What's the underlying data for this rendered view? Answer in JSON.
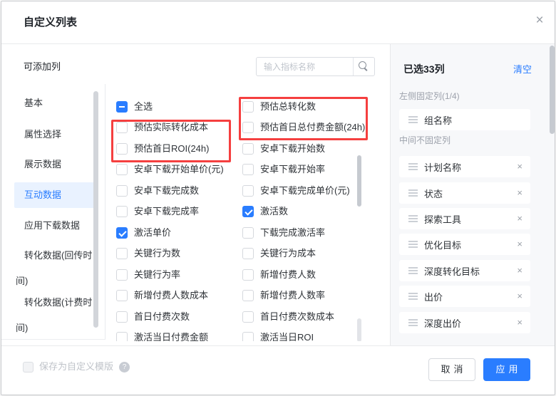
{
  "dialog": {
    "title": "自定义列表"
  },
  "icons": {
    "close": "×",
    "remove": "×",
    "help": "?",
    "search": "magnifier-icon",
    "drag": "triple-bar-handle"
  },
  "addable": {
    "label": "可添加列",
    "search_placeholder": "输入指标名称",
    "categories": [
      {
        "label": "基本",
        "active": false
      },
      {
        "label": "属性选择",
        "active": false
      },
      {
        "label": "展示数据",
        "active": false
      },
      {
        "label": "互动数据",
        "active": true
      },
      {
        "label": "应用下载数据",
        "active": false
      },
      {
        "label": "转化数据(回传时\n间)",
        "active": false
      },
      {
        "label": "转化数据(计费时\n间)",
        "active": false
      }
    ]
  },
  "metrics": {
    "col1": [
      {
        "label": "全选",
        "state": "indeterminate",
        "highlighted": false
      },
      {
        "label": "预估实际转化成本",
        "state": "unchecked",
        "highlighted": true
      },
      {
        "label": "预估首日ROI(24h)",
        "state": "unchecked",
        "highlighted": true
      },
      {
        "label": "安卓下载开始单价(元)",
        "state": "unchecked",
        "highlighted": false
      },
      {
        "label": "安卓下载完成数",
        "state": "unchecked",
        "highlighted": false
      },
      {
        "label": "安卓下载完成率",
        "state": "unchecked",
        "highlighted": false
      },
      {
        "label": "激活单价",
        "state": "checked",
        "highlighted": false
      },
      {
        "label": "关键行为数",
        "state": "unchecked",
        "highlighted": false
      },
      {
        "label": "关键行为率",
        "state": "unchecked",
        "highlighted": false
      },
      {
        "label": "新增付费人数成本",
        "state": "unchecked",
        "highlighted": false
      },
      {
        "label": "首日付费次数",
        "state": "unchecked",
        "highlighted": false
      },
      {
        "label": "激活当日付费金额",
        "state": "unchecked",
        "highlighted": false
      }
    ],
    "col2": [
      {
        "label": "预估总转化数",
        "state": "unchecked",
        "highlighted": true
      },
      {
        "label": "预估首日总付费金额(24h)",
        "state": "unchecked",
        "highlighted": true
      },
      {
        "label": "安卓下载开始数",
        "state": "unchecked",
        "highlighted": false
      },
      {
        "label": "安卓下载开始率",
        "state": "unchecked",
        "highlighted": false
      },
      {
        "label": "安卓下载完成单价(元)",
        "state": "unchecked",
        "highlighted": false
      },
      {
        "label": "激活数",
        "state": "checked",
        "highlighted": false
      },
      {
        "label": "下载完成激活率",
        "state": "unchecked",
        "highlighted": false
      },
      {
        "label": "关键行为成本",
        "state": "unchecked",
        "highlighted": false
      },
      {
        "label": "新增付费人数",
        "state": "unchecked",
        "highlighted": false
      },
      {
        "label": "新增付费人数率",
        "state": "unchecked",
        "highlighted": false
      },
      {
        "label": "首日付费次数成本",
        "state": "unchecked",
        "highlighted": false
      },
      {
        "label": "激活当日ROI",
        "state": "unchecked",
        "highlighted": false
      }
    ]
  },
  "selected": {
    "title": "已选33列",
    "clear": "清空",
    "fixed_label": "左侧固定列(1/4)",
    "fixed_items": [
      "组名称"
    ],
    "unfixed_label": "中间不固定列",
    "unfixed_items": [
      "计划名称",
      "状态",
      "探索工具",
      "优化目标",
      "深度转化目标",
      "出价",
      "深度出价"
    ]
  },
  "footer": {
    "save_template": "保存为自定义模版",
    "cancel": "取消",
    "apply": "应用"
  },
  "colors": {
    "accent_blue": "#2a7dff",
    "highlight_red": "#f53f3f",
    "active_category_bg": "#e9f2ff",
    "panel_bg": "#f7f8fa"
  }
}
